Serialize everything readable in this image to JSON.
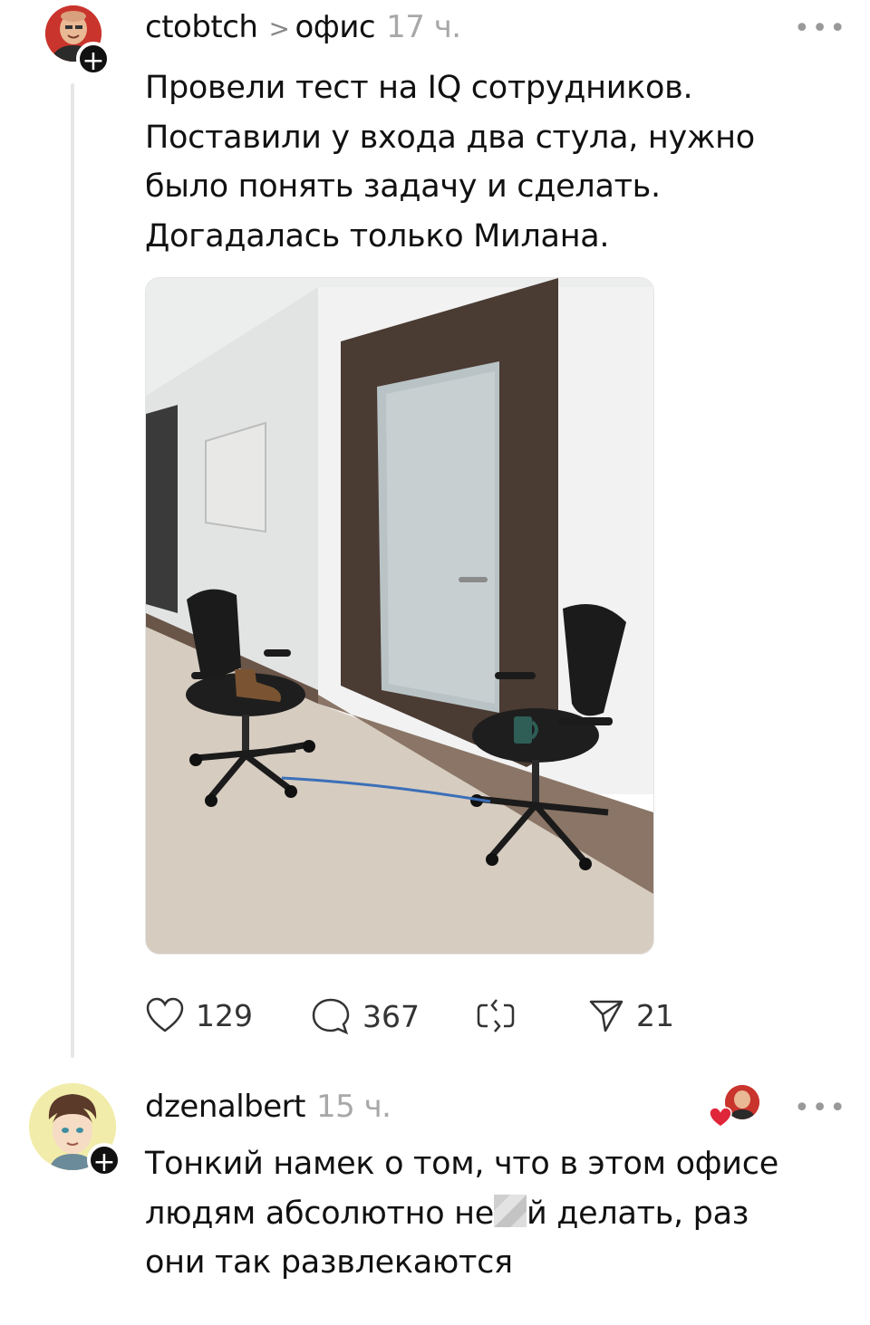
{
  "post": {
    "username": "ctobtch",
    "chevron": ">",
    "topic": "офис",
    "time": "17 ч.",
    "more": "•••",
    "lines": [
      "Провели тест на IQ сотрудников.",
      "Поставили у входа два стула, нужно",
      "было понять задачу и сделать.",
      "Догадалась только Милана."
    ],
    "image": "office corridor photo: two office chairs tied with a blue rope, a boot on one chair and a mug on the other, by a frosted glass door",
    "actions": {
      "likes": "129",
      "comments": "367",
      "shares": "21"
    }
  },
  "reply": {
    "username": "dzenalbert",
    "time": "15 ч.",
    "more": "•••",
    "line1": "Тонкий намек о том, что в этом офисе",
    "line2_before": "людям абсолютно не",
    "line2_after": "й делать, раз",
    "line3": "они так развлекаются"
  },
  "colors": {
    "text": "#111111",
    "muted": "#a8a8a8",
    "heart": "#e0263a",
    "avatar_bg": "#c9342c",
    "reply_avatar_bg": "#f2ecab"
  }
}
